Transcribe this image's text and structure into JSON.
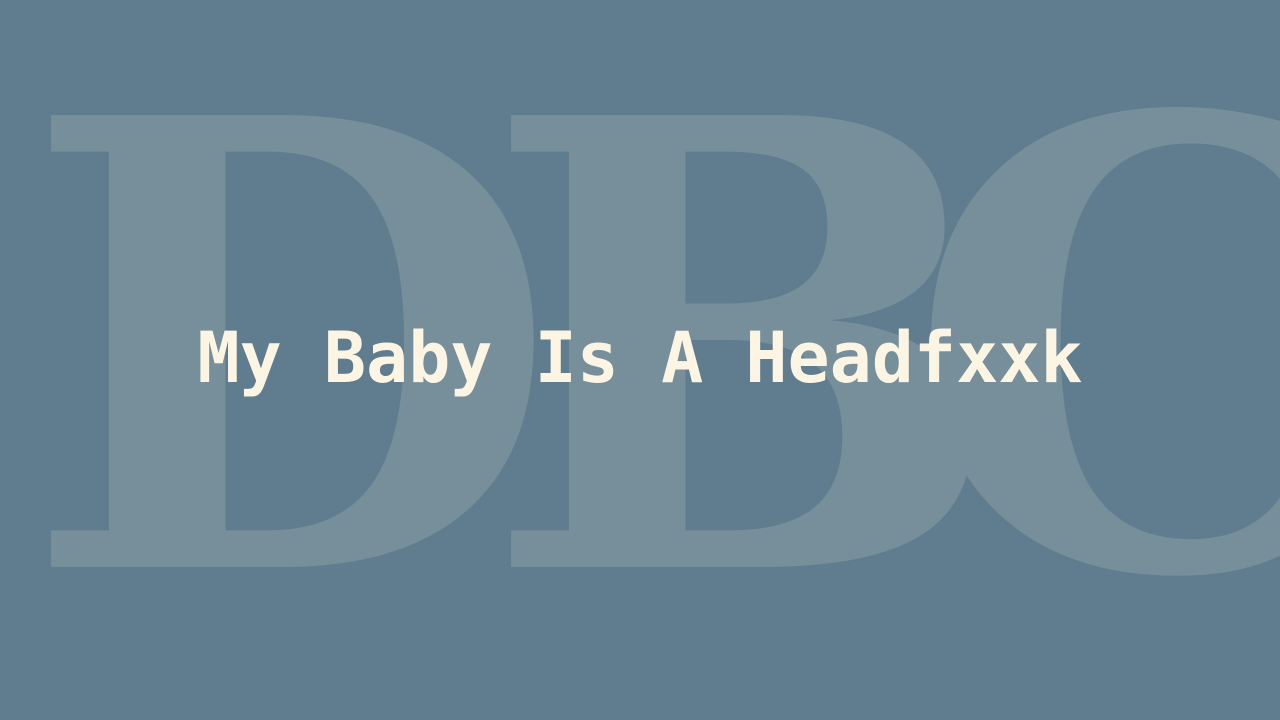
{
  "background": {
    "color": "#5f7d8e",
    "watermark_color": "#778e9b",
    "watermark_letters": [
      "D",
      "B",
      "C"
    ]
  },
  "title": {
    "text": "My Baby Is A Headfxxk",
    "color": "#fcf5e4"
  }
}
